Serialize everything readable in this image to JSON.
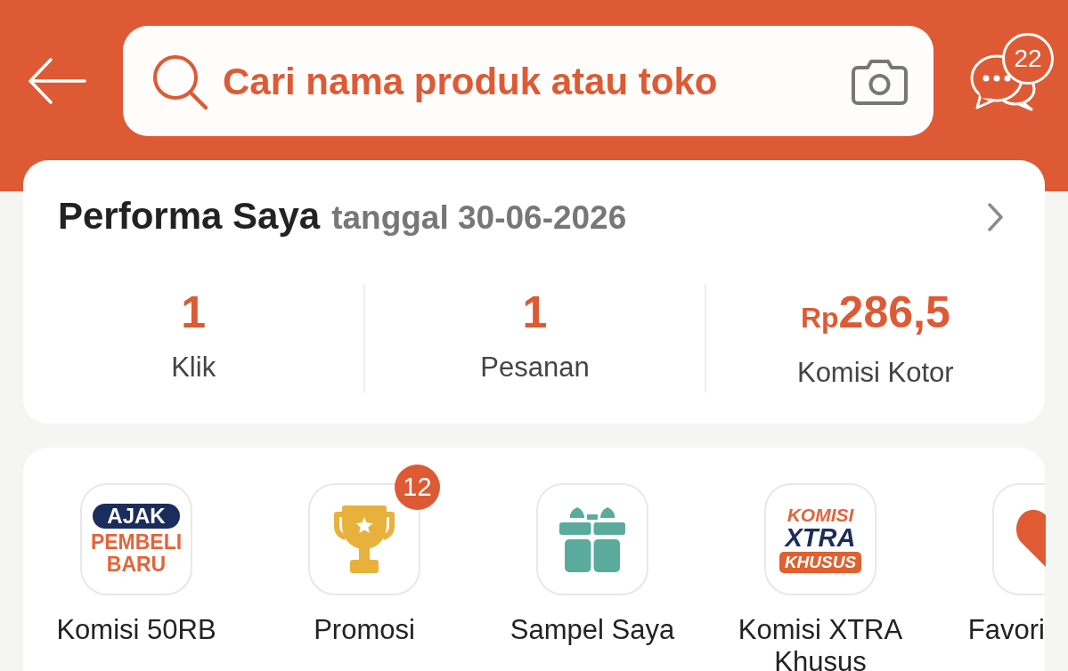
{
  "header": {
    "search": {
      "placeholder": "Cari nama produk atau toko"
    },
    "chat": {
      "badge": "22"
    }
  },
  "performance": {
    "title": "Performa Saya",
    "date": "tanggal 30-06-2026",
    "stats": [
      {
        "value": "1",
        "label": "Klik"
      },
      {
        "value": "1",
        "label": "Pesanan"
      },
      {
        "currency": "Rp",
        "value": "286,5",
        "label": "Komisi Kotor"
      }
    ]
  },
  "shortcuts": [
    {
      "kind": "ajak-logo",
      "logo_lines": [
        "AJAK",
        "PEMBELI",
        "BARU"
      ],
      "label": "Komisi 50RB"
    },
    {
      "kind": "trophy",
      "badge": "12",
      "label": "Promosi"
    },
    {
      "kind": "gift",
      "label": "Sampel Saya"
    },
    {
      "kind": "xtra-logo",
      "logo_lines": [
        "KOMISI",
        "XTRA",
        "KHUSUS"
      ],
      "label": "Komisi XTRA Khusus"
    },
    {
      "kind": "heart",
      "label": "Favori"
    }
  ]
}
